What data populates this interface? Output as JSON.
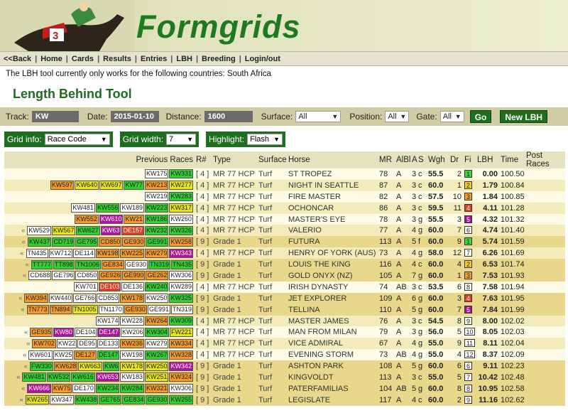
{
  "banner": {
    "logo": "Formgrids",
    "saddle_number": "3"
  },
  "nav": {
    "items": [
      "<<Back",
      "Home",
      "Cards",
      "Results",
      "Entries",
      "LBH",
      "Breeding",
      "Login/out"
    ]
  },
  "notice": "The LBH tool currently only works for the following countries: South Africa",
  "page_title": "Length Behind Tool",
  "filters": {
    "track_label": "Track:",
    "track": "KW",
    "date_label": "Date:",
    "date": "2015-01-10",
    "distance_label": "Distance:",
    "distance": "1600",
    "surface_label": "Surface:",
    "surface": "All",
    "position_label": "Position:",
    "position": "All",
    "gate_label": "Gate:",
    "gate": "All",
    "go": "Go",
    "new_lbh": "New LBH"
  },
  "options": {
    "grid_info_label": "Grid info:",
    "grid_info": "Race Code",
    "grid_width_label": "Grid width:",
    "grid_width": "7",
    "highlight_label": "Highlight:",
    "highlight": "Flash"
  },
  "table": {
    "headers": [
      "Previous Races",
      "R#",
      "Type",
      "Surface",
      "Horse",
      "MR",
      "AlBl",
      "A",
      "S",
      "Wgh",
      "Dr",
      "Fi",
      "LBH",
      "Time",
      "Post Races"
    ],
    "rows": [
      {
        "prev": [
          [
            "KW175",
            "w"
          ],
          [
            "KW331",
            "g"
          ]
        ],
        "more": false,
        "rn": "[ 4 ]",
        "type": "MR 77 HCP",
        "surface": "Turf",
        "horse": "ST TROPEZ",
        "mr": "78",
        "albl": "A",
        "a": "3",
        "s": "c",
        "wgh": "55.5",
        "dr": "2",
        "fi": "1",
        "fic": "f1",
        "lbh": "0.00",
        "time": "100.50",
        "grade": false
      },
      {
        "prev": [
          [
            "KW597",
            "o"
          ],
          [
            "KW640",
            "y"
          ],
          [
            "KW697",
            "y"
          ],
          [
            "KW77",
            "g"
          ],
          [
            "KW213",
            "o"
          ],
          [
            "KW277",
            "y"
          ]
        ],
        "more": false,
        "rn": "[ 4 ]",
        "type": "MR 77 HCP",
        "surface": "Turf",
        "horse": "NIGHT IN SEATTLE",
        "mr": "87",
        "albl": "A",
        "a": "3",
        "s": "c",
        "wgh": "60.0",
        "dr": "1",
        "fi": "2",
        "fic": "f2",
        "lbh": "1.79",
        "time": "100.84",
        "grade": false
      },
      {
        "prev": [
          [
            "KW219",
            "w"
          ],
          [
            "KW283",
            "g"
          ]
        ],
        "more": false,
        "rn": "[ 4 ]",
        "type": "MR 77 HCP",
        "surface": "Turf",
        "horse": "FIRE MASTER",
        "mr": "82",
        "albl": "A",
        "a": "3",
        "s": "c",
        "wgh": "57.5",
        "dr": "10",
        "fi": "3",
        "fic": "f3",
        "lbh": "1.84",
        "time": "100.85",
        "grade": false
      },
      {
        "prev": [
          [
            "KW481",
            "w"
          ],
          [
            "KW556",
            "g"
          ],
          [
            "KW189",
            "w"
          ],
          [
            "KW223",
            "g"
          ],
          [
            "KW317",
            "y"
          ]
        ],
        "more": false,
        "rn": "[ 4 ]",
        "type": "MR 77 HCP",
        "surface": "Turf",
        "horse": "OCHONCAR",
        "mr": "86",
        "albl": "A",
        "a": "3",
        "s": "c",
        "wgh": "59.5",
        "dr": "11",
        "fi": "4",
        "fic": "f4",
        "lbh": "4.11",
        "time": "101.28",
        "grade": false
      },
      {
        "prev": [
          [
            "KW552",
            "o"
          ],
          [
            "KW610",
            "p"
          ],
          [
            "KW21",
            "o"
          ],
          [
            "KW186",
            "g"
          ],
          [
            "KW260",
            "w"
          ]
        ],
        "more": false,
        "rn": "[ 4 ]",
        "type": "MR 77 HCP",
        "surface": "Turf",
        "horse": "MASTER'S EYE",
        "mr": "78",
        "albl": "A",
        "a": "3",
        "s": "g",
        "wgh": "55.5",
        "dr": "3",
        "fi": "5",
        "fic": "f5",
        "lbh": "4.32",
        "time": "101.32",
        "grade": false
      },
      {
        "prev": [
          [
            "KW529",
            "w"
          ],
          [
            "KW567",
            "y"
          ],
          [
            "KW627",
            "g"
          ],
          [
            "KW63",
            "p"
          ],
          [
            "DE157",
            "r"
          ],
          [
            "KW232",
            "g"
          ],
          [
            "KW326",
            "g"
          ]
        ],
        "more": true,
        "rn": "[ 4 ]",
        "type": "MR 77 HCP",
        "surface": "Turf",
        "horse": "VALERIO",
        "mr": "77",
        "albl": "A",
        "a": "4",
        "s": "g",
        "wgh": "60.0",
        "dr": "7",
        "fi": "6",
        "fic": "fx",
        "lbh": "4.74",
        "time": "101.40",
        "grade": false
      },
      {
        "prev": [
          [
            "KW437",
            "g"
          ],
          [
            "CD719",
            "g"
          ],
          [
            "GE795",
            "g"
          ],
          [
            "CD850",
            "o"
          ],
          [
            "GE930",
            "o"
          ],
          [
            "GE991",
            "g"
          ],
          [
            "KW258",
            "o"
          ]
        ],
        "more": true,
        "rn": "[ 9 ]",
        "type": "Grade 1",
        "surface": "Turf",
        "horse": "FUTURA",
        "mr": "113",
        "albl": "A",
        "a": "5",
        "s": "f",
        "wgh": "60.0",
        "dr": "9",
        "fi": "1",
        "fic": "f1",
        "lbh": "5.74",
        "time": "101.59",
        "grade": true
      },
      {
        "prev": [
          [
            "TN435",
            "w"
          ],
          [
            "KW712",
            "w"
          ],
          [
            "DE114",
            "w"
          ],
          [
            "KW198",
            "o"
          ],
          [
            "KW225",
            "o"
          ],
          [
            "KW279",
            "o"
          ],
          [
            "KW343",
            "p"
          ]
        ],
        "more": true,
        "rn": "[ 4 ]",
        "type": "MR 77 HCP",
        "surface": "Turf",
        "horse": "HENRY OF YORK (AUS)",
        "mr": "73",
        "albl": "A",
        "a": "4",
        "s": "g",
        "wgh": "58.0",
        "dr": "12",
        "fi": "7",
        "fic": "fx",
        "lbh": "6.26",
        "time": "101.69",
        "grade": false
      },
      {
        "prev": [
          [
            "TT777",
            "g"
          ],
          [
            "TT898",
            "g"
          ],
          [
            "TN1006",
            "g"
          ],
          [
            "GE834",
            "o"
          ],
          [
            "GE930",
            "w"
          ],
          [
            "TN319",
            "g"
          ],
          [
            "TN435",
            "g"
          ]
        ],
        "more": true,
        "rn": "[ 9 ]",
        "type": "Grade 1",
        "surface": "Turf",
        "horse": "LOUIS THE KING",
        "mr": "116",
        "albl": "A",
        "a": "4",
        "s": "c",
        "wgh": "60.0",
        "dr": "4",
        "fi": "2",
        "fic": "f2",
        "lbh": "6.53",
        "time": "101.74",
        "grade": true
      },
      {
        "prev": [
          [
            "CD688",
            "w"
          ],
          [
            "GE796",
            "w"
          ],
          [
            "CD850",
            "w"
          ],
          [
            "GE926",
            "o"
          ],
          [
            "GE990",
            "o"
          ],
          [
            "GE262",
            "o"
          ],
          [
            "KW306",
            "w"
          ]
        ],
        "more": true,
        "rn": "[ 9 ]",
        "type": "Grade 1",
        "surface": "Turf",
        "horse": "GOLD ONYX (NZ)",
        "mr": "105",
        "albl": "A",
        "a": "7",
        "s": "g",
        "wgh": "60.0",
        "dr": "1",
        "fi": "3",
        "fic": "f3",
        "lbh": "7.53",
        "time": "101.93",
        "grade": true
      },
      {
        "prev": [
          [
            "KW701",
            "w"
          ],
          [
            "DE103",
            "r"
          ],
          [
            "DE136",
            "w"
          ],
          [
            "KW240",
            "g"
          ],
          [
            "KW289",
            "w"
          ]
        ],
        "more": false,
        "rn": "[ 4 ]",
        "type": "MR 77 HCP",
        "surface": "Turf",
        "horse": "IRISH DYNASTY",
        "mr": "74",
        "albl": "AB",
        "a": "3",
        "s": "c",
        "wgh": "53.5",
        "dr": "6",
        "fi": "8",
        "fic": "fx",
        "lbh": "7.58",
        "time": "101.94",
        "grade": false
      },
      {
        "prev": [
          [
            "KW394",
            "o"
          ],
          [
            "KW440",
            "w"
          ],
          [
            "GE766",
            "w"
          ],
          [
            "CD853",
            "w"
          ],
          [
            "KW178",
            "o"
          ],
          [
            "KW250",
            "w"
          ],
          [
            "KW325",
            "g"
          ]
        ],
        "more": true,
        "rn": "[ 9 ]",
        "type": "Grade 1",
        "surface": "Turf",
        "horse": "JET EXPLORER",
        "mr": "109",
        "albl": "A",
        "a": "6",
        "s": "g",
        "wgh": "60.0",
        "dr": "3",
        "fi": "4",
        "fic": "f4",
        "lbh": "7.63",
        "time": "101.95",
        "grade": true
      },
      {
        "prev": [
          [
            "TN773",
            "o"
          ],
          [
            "TN894",
            "o"
          ],
          [
            "TN1005",
            "y"
          ],
          [
            "TN1170",
            "w"
          ],
          [
            "GE930",
            "o"
          ],
          [
            "GE991",
            "w"
          ],
          [
            "TN319",
            "w"
          ]
        ],
        "more": true,
        "rn": "[ 9 ]",
        "type": "Grade 1",
        "surface": "Turf",
        "horse": "TELLINA",
        "mr": "110",
        "albl": "A",
        "a": "5",
        "s": "g",
        "wgh": "60.0",
        "dr": "7",
        "fi": "5",
        "fic": "f5",
        "lbh": "7.84",
        "time": "101.99",
        "grade": true
      },
      {
        "prev": [
          [
            "KW174",
            "w"
          ],
          [
            "KW228",
            "w"
          ],
          [
            "KW264",
            "o"
          ],
          [
            "KW309",
            "g"
          ]
        ],
        "more": false,
        "rn": "[ 4 ]",
        "type": "MR 77 HCP",
        "surface": "Turf",
        "horse": "MASTER JAMES",
        "mr": "76",
        "albl": "A",
        "a": "3",
        "s": "c",
        "wgh": "54.5",
        "dr": "8",
        "fi": "9",
        "fic": "fx",
        "lbh": "8.00",
        "time": "102.02",
        "grade": false
      },
      {
        "prev": [
          [
            "GE935",
            "o"
          ],
          [
            "KW80",
            "p"
          ],
          [
            "DE104",
            "w"
          ],
          [
            "DE147",
            "p"
          ],
          [
            "KW206",
            "w"
          ],
          [
            "KW304",
            "g"
          ],
          [
            "FW221",
            "y"
          ]
        ],
        "more": true,
        "rn": "[ 4 ]",
        "type": "MR 77 HCP",
        "surface": "Turf",
        "horse": "MAN FROM MILAN",
        "mr": "79",
        "albl": "A",
        "a": "3",
        "s": "g",
        "wgh": "56.0",
        "dr": "5",
        "fi": "10",
        "fic": "fx",
        "lbh": "8.05",
        "time": "102.03",
        "grade": false
      },
      {
        "prev": [
          [
            "KW702",
            "o"
          ],
          [
            "KW22",
            "w"
          ],
          [
            "DE95",
            "w"
          ],
          [
            "DE133",
            "w"
          ],
          [
            "KW236",
            "o"
          ],
          [
            "KW279",
            "w"
          ],
          [
            "KW334",
            "o"
          ]
        ],
        "more": true,
        "rn": "[ 4 ]",
        "type": "MR 77 HCP",
        "surface": "Turf",
        "horse": "VICE ADMIRAL",
        "mr": "67",
        "albl": "A",
        "a": "4",
        "s": "g",
        "wgh": "55.0",
        "dr": "9",
        "fi": "11",
        "fic": "fx",
        "lbh": "8.11",
        "time": "102.04",
        "grade": false
      },
      {
        "prev": [
          [
            "KW601",
            "w"
          ],
          [
            "KW25",
            "w"
          ],
          [
            "DE127",
            "o"
          ],
          [
            "DE147",
            "g"
          ],
          [
            "KW198",
            "w"
          ],
          [
            "KW267",
            "g"
          ],
          [
            "KW328",
            "o"
          ]
        ],
        "more": true,
        "rn": "[ 4 ]",
        "type": "MR 77 HCP",
        "surface": "Turf",
        "horse": "EVENING STORM",
        "mr": "73",
        "albl": "AB",
        "a": "4",
        "s": "g",
        "wgh": "55.0",
        "dr": "4",
        "fi": "12",
        "fic": "fx",
        "lbh": "8.37",
        "time": "102.09",
        "grade": false
      },
      {
        "prev": [
          [
            "FW330",
            "g"
          ],
          [
            "KW628",
            "o"
          ],
          [
            "KW663",
            "y"
          ],
          [
            "KW6",
            "g"
          ],
          [
            "KW178",
            "y"
          ],
          [
            "KW250",
            "y"
          ],
          [
            "KW342",
            "p"
          ]
        ],
        "more": true,
        "rn": "[ 9 ]",
        "type": "Grade 1",
        "surface": "Turf",
        "horse": "ASHTON PARK",
        "mr": "108",
        "albl": "A",
        "a": "5",
        "s": "g",
        "wgh": "60.0",
        "dr": "6",
        "fi": "6",
        "fic": "fx",
        "lbh": "9.11",
        "time": "102.23",
        "grade": true
      },
      {
        "prev": [
          [
            "KW481",
            "g"
          ],
          [
            "KW532",
            "g"
          ],
          [
            "KW616",
            "g"
          ],
          [
            "KW653",
            "p"
          ],
          [
            "KW183",
            "w"
          ],
          [
            "KW251",
            "y"
          ],
          [
            "KW324",
            "o"
          ]
        ],
        "more": true,
        "rn": "[ 9 ]",
        "type": "Grade 1",
        "surface": "Turf",
        "horse": "KINGVOLDT",
        "mr": "113",
        "albl": "A",
        "a": "3",
        "s": "c",
        "wgh": "55.0",
        "dr": "5",
        "fi": "7",
        "fic": "fx",
        "lbh": "10.42",
        "time": "102.48",
        "grade": true
      },
      {
        "prev": [
          [
            "KW666",
            "p"
          ],
          [
            "KW75",
            "o"
          ],
          [
            "DE170",
            "w"
          ],
          [
            "KW234",
            "g"
          ],
          [
            "KW284",
            "g"
          ],
          [
            "KW321",
            "o"
          ],
          [
            "KW306",
            "w"
          ]
        ],
        "more": true,
        "rn": "[ 9 ]",
        "type": "Grade 1",
        "surface": "Turf",
        "horse": "PATERFAMILIAS",
        "mr": "104",
        "albl": "AB",
        "a": "5",
        "s": "g",
        "wgh": "60.0",
        "dr": "8",
        "fi": "8",
        "fic": "fx",
        "lbh": "10.95",
        "time": "102.58",
        "grade": true
      },
      {
        "prev": [
          [
            "KW265",
            "y"
          ],
          [
            "KW347",
            "w"
          ],
          [
            "KW438",
            "g"
          ],
          [
            "GE765",
            "g"
          ],
          [
            "GE834",
            "g"
          ],
          [
            "GE930",
            "g"
          ],
          [
            "KW255",
            "g"
          ]
        ],
        "more": true,
        "rn": "[ 9 ]",
        "type": "Grade 1",
        "surface": "Turf",
        "horse": "LEGISLATE",
        "mr": "117",
        "albl": "A",
        "a": "4",
        "s": "c",
        "wgh": "60.0",
        "dr": "2",
        "fi": "9",
        "fic": "fx",
        "lbh": "11.16",
        "time": "102.62",
        "grade": true
      }
    ]
  }
}
